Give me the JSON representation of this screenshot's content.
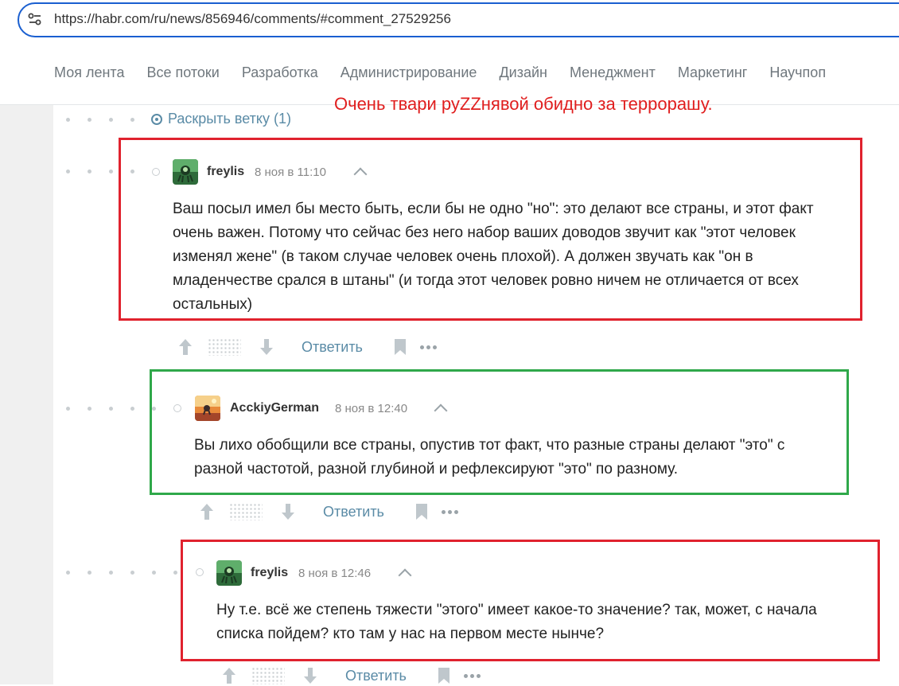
{
  "browser": {
    "url": "https://habr.com/ru/news/856946/comments/#comment_27529256"
  },
  "nav": {
    "items": [
      "Моя лента",
      "Все потоки",
      "Разработка",
      "Администрирование",
      "Дизайн",
      "Менеджмент",
      "Маркетинг",
      "Научпоп"
    ]
  },
  "thread": {
    "expand_label": "Раскрыть ветку (1)"
  },
  "annotation": {
    "text": "Очень твари руZZнявой обидно за террорашу."
  },
  "comments": [
    {
      "author": "freylis",
      "time": "8 ноя в 11:10",
      "lines": [
        "Ваш посыл имел бы место быть, если бы не одно \"но\": это делают все страны, и этот факт",
        "очень важен. Потому что сейчас без него набор ваших доводов звучит как \"этот человек",
        "изменял жене\" (в таком случае человек очень плохой). А должен звучать как \"он в",
        "младенчестве срался в штаны\" (и тогда этот человек ровно ничем не отличается от всех",
        "остальных)"
      ],
      "reply_label": "Ответить"
    },
    {
      "author": "AcckiyGerman",
      "time": "8 ноя в 12:40",
      "lines": [
        "Вы лихо обобщили все страны, опустив тот факт, что разные страны делают \"это\" с",
        "разной частотой, разной глубиной и рефлексируют \"это\" по разному."
      ],
      "reply_label": "Ответить"
    },
    {
      "author": "freylis",
      "time": "8 ноя в 12:46",
      "lines": [
        "Ну т.е. всё же степень тяжести \"этого\" имеет какое-то значение? так, может, с начала",
        "списка пойдем? кто там у нас на первом месте нынче?"
      ],
      "reply_label": "Ответить"
    }
  ],
  "colors": {
    "annotation_red": "#e0222e",
    "annotation_green": "#2fa84a",
    "link": "#5a8ba6",
    "address_bar_border": "#1a5fd0"
  }
}
